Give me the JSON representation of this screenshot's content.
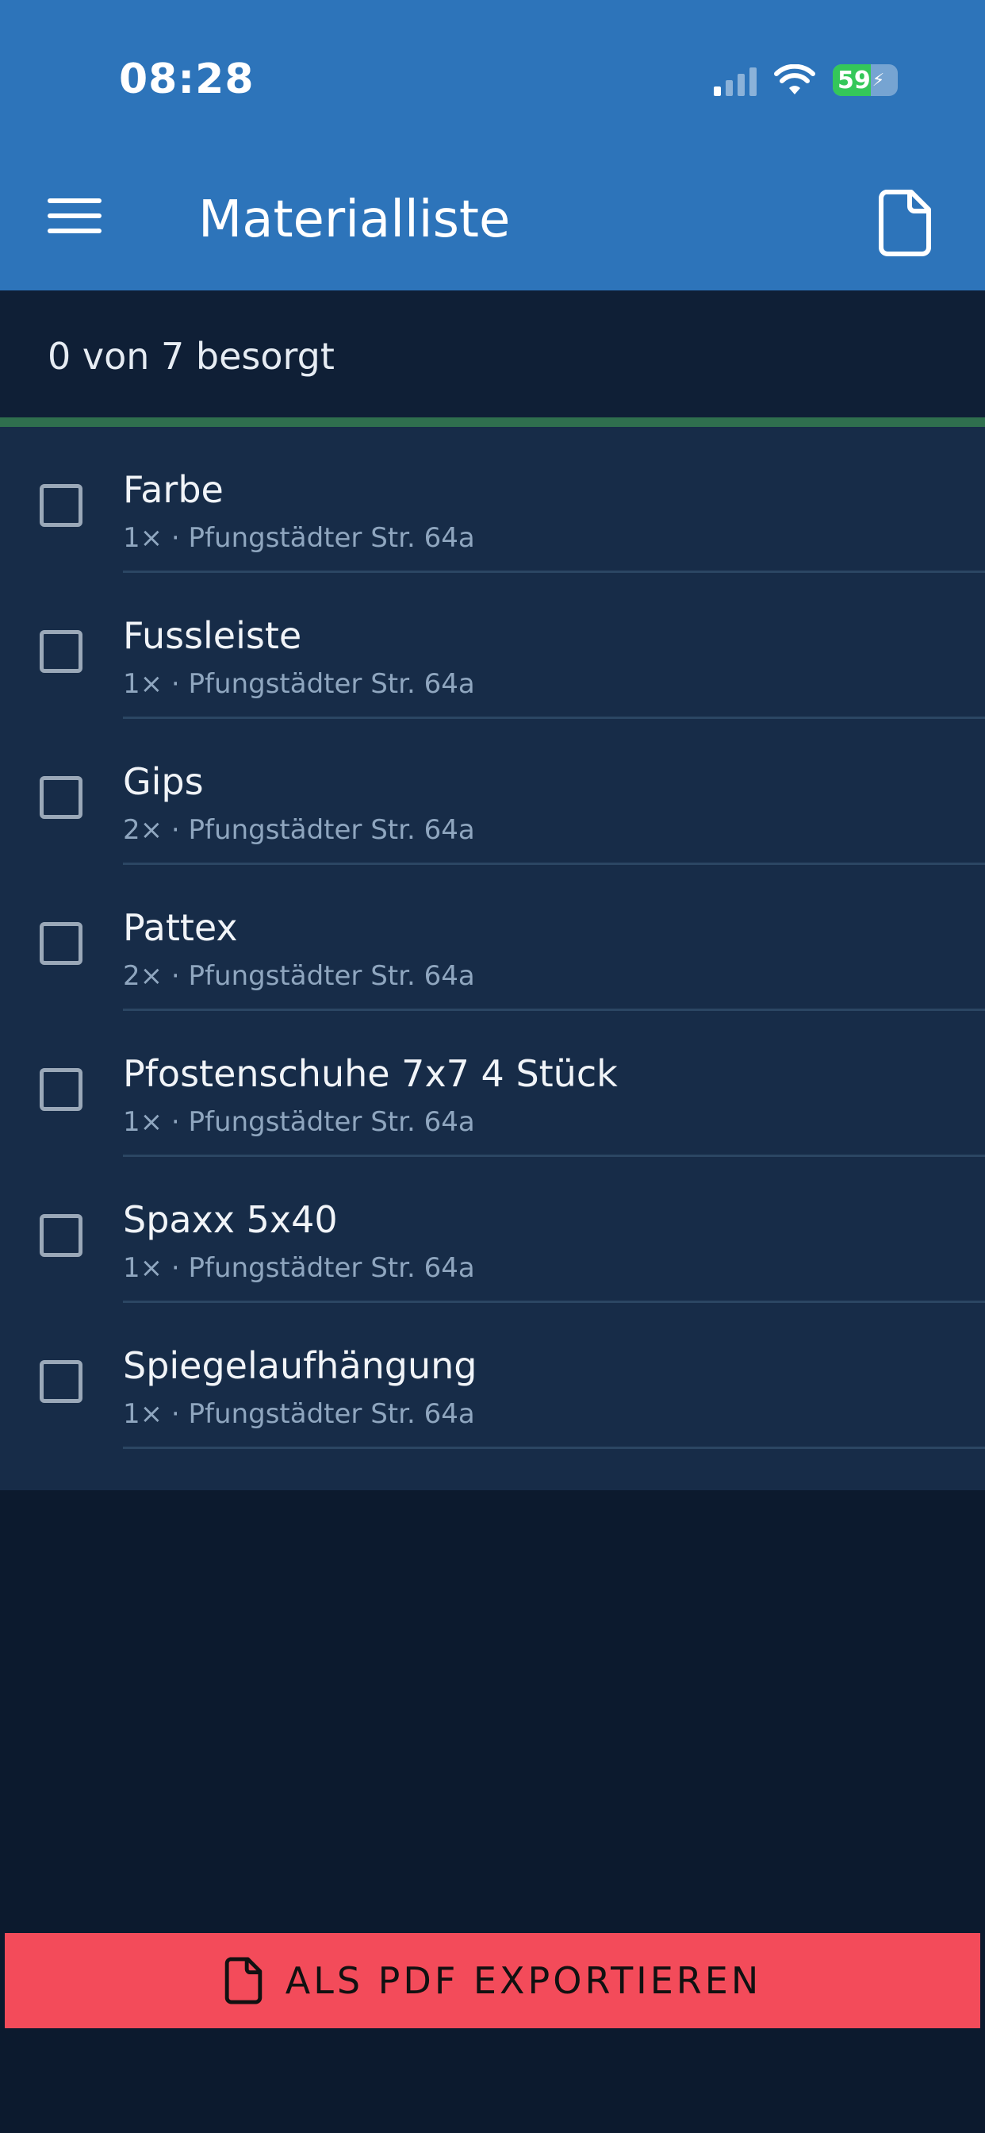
{
  "status_bar": {
    "time": "08:28",
    "battery_text": "59",
    "battery_level_percent": 59,
    "signal_bars_active": 1,
    "signal_bars_total": 4
  },
  "header": {
    "title": "Materialliste",
    "menu_icon": "hamburger-menu-icon",
    "action_icon": "document-icon",
    "background_color": "#2d74ba"
  },
  "progress": {
    "text": "0 von 7 besorgt",
    "done": 0,
    "total": 7
  },
  "items": [
    {
      "name": "Farbe",
      "detail": "1× · Pfungstädter Str. 64a",
      "checked": false
    },
    {
      "name": "Fussleiste",
      "detail": "1× · Pfungstädter Str. 64a",
      "checked": false
    },
    {
      "name": "Gips",
      "detail": "2× · Pfungstädter Str. 64a",
      "checked": false
    },
    {
      "name": "Pattex",
      "detail": "2× · Pfungstädter Str. 64a",
      "checked": false
    },
    {
      "name": "Pfostenschuhe 7x7 4 Stück",
      "detail": "1× · Pfungstädter Str. 64a",
      "checked": false
    },
    {
      "name": "Spaxx 5x40",
      "detail": "1× · Pfungstädter Str. 64a",
      "checked": false
    },
    {
      "name": "Spiegelaufhängung",
      "detail": "1× · Pfungstädter Str. 64a",
      "checked": false
    }
  ],
  "export_button": {
    "label": "ALS PDF EXPORTIEREN",
    "icon": "document-icon",
    "color": "#f34b5a"
  }
}
